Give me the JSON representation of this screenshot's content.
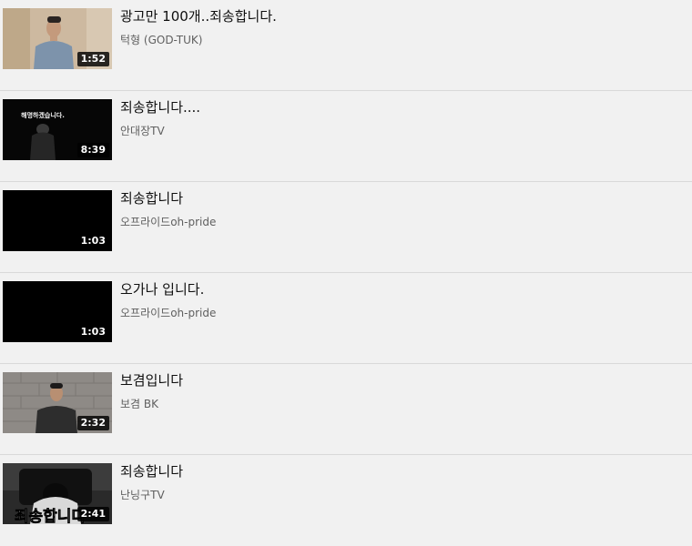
{
  "videos": [
    {
      "title": "광고만 100개..죄송합니다.",
      "channel": "턱형 (GOD-TUK)",
      "duration": "1:52",
      "thumb": "person-standing-light-wall"
    },
    {
      "title": "죄송합니다....",
      "channel": "안대장TV",
      "duration": "8:39",
      "thumb": "person-bowing-dark",
      "thumb_text": "해명하겠습니다."
    },
    {
      "title": "죄송합니다",
      "channel": "오프라이드oh-pride",
      "duration": "1:03",
      "thumb": "black"
    },
    {
      "title": "오가나 입니다.",
      "channel": "오프라이드oh-pride",
      "duration": "1:03",
      "thumb": "black"
    },
    {
      "title": "보겸입니다",
      "channel": "보겸 BK",
      "duration": "2:32",
      "thumb": "person-brick-wall"
    },
    {
      "title": "죄송합니다",
      "channel": "난닝구TV",
      "duration": "2:41",
      "thumb": "person-bowing-chair",
      "thumb_text": "죄송합니다"
    }
  ]
}
